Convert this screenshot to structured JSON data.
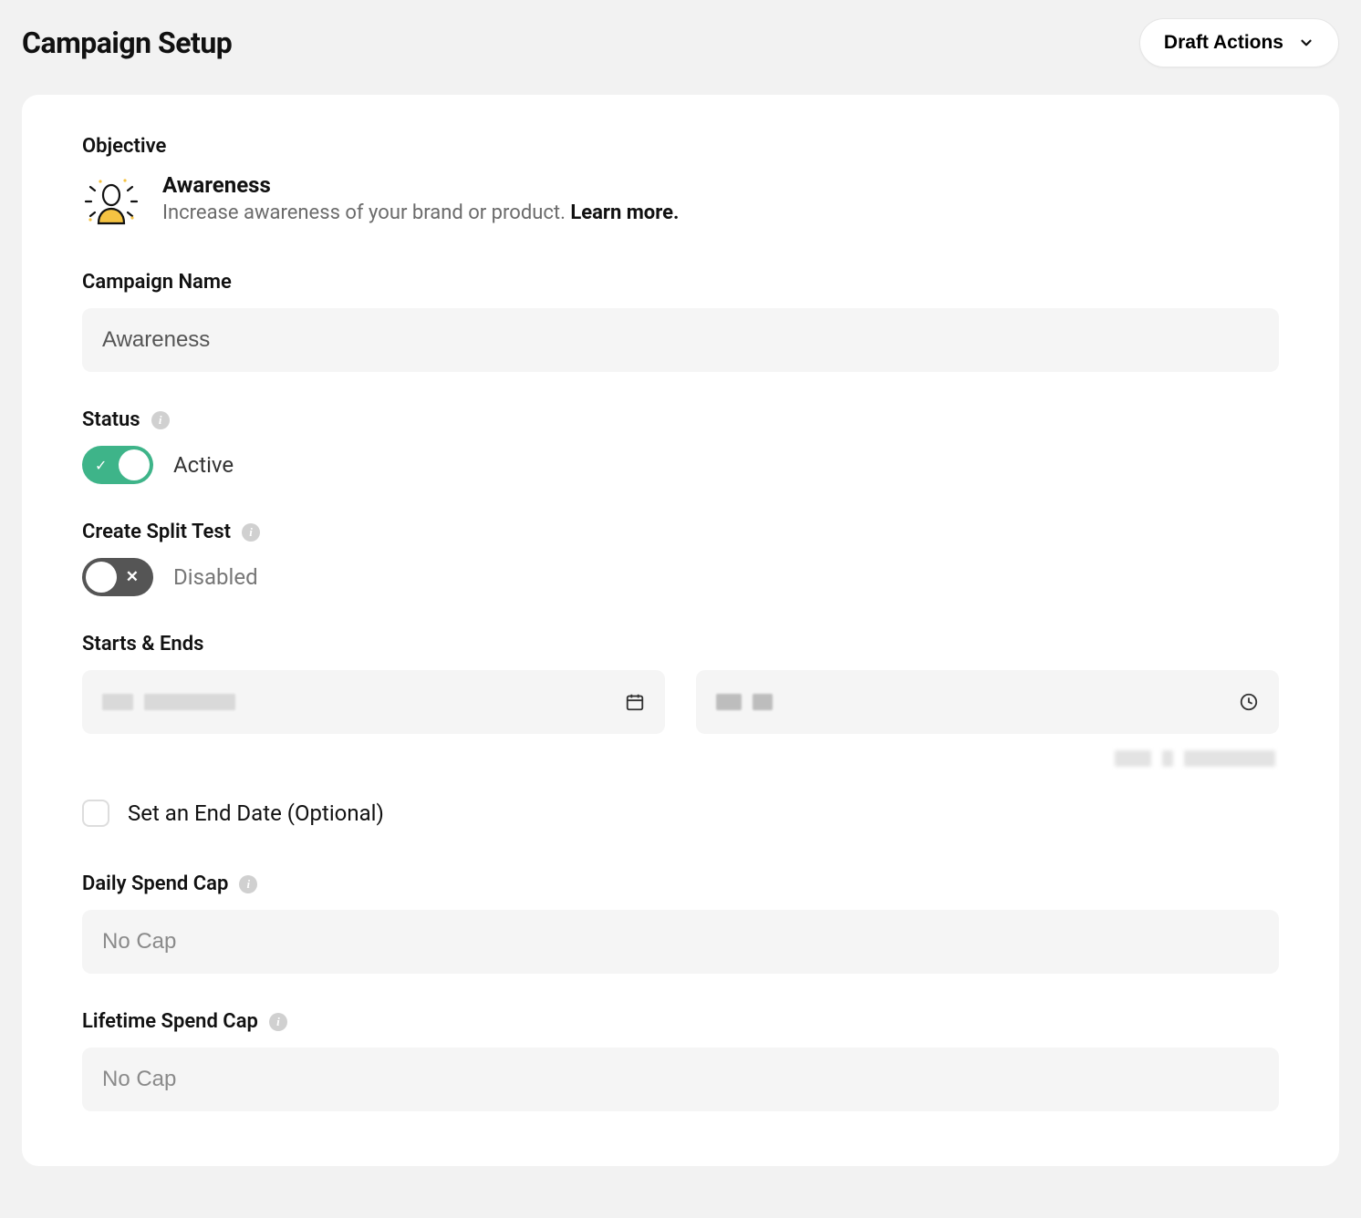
{
  "header": {
    "title": "Campaign Setup",
    "draft_actions_label": "Draft Actions"
  },
  "objective": {
    "label": "Objective",
    "title": "Awareness",
    "description": "Increase awareness of your brand or product. ",
    "learn_more": "Learn more."
  },
  "campaign_name": {
    "label": "Campaign Name",
    "value": "Awareness"
  },
  "status": {
    "label": "Status",
    "on": true,
    "text": "Active"
  },
  "split_test": {
    "label": "Create Split Test",
    "on": false,
    "text": "Disabled"
  },
  "schedule": {
    "label": "Starts & Ends",
    "set_end_label": "Set an End Date (Optional)"
  },
  "daily_cap": {
    "label": "Daily Spend Cap",
    "placeholder": "No Cap",
    "value": ""
  },
  "lifetime_cap": {
    "label": "Lifetime Spend Cap",
    "placeholder": "No Cap",
    "value": ""
  }
}
